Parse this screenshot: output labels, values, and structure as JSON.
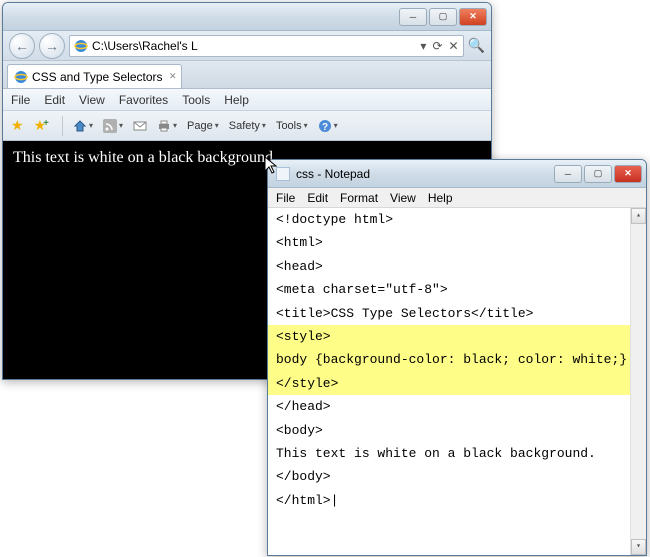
{
  "ie": {
    "address": "C:\\Users\\Rachel's L",
    "tab_title": "CSS and Type Selectors",
    "menu": {
      "file": "File",
      "edit": "Edit",
      "view": "View",
      "favorites": "Favorites",
      "tools": "Tools",
      "help": "Help"
    },
    "toolbar": {
      "page": "Page",
      "safety": "Safety",
      "tools": "Tools"
    },
    "page_text": "This text is white on a black background."
  },
  "notepad": {
    "title": "css - Notepad",
    "menu": {
      "file": "File",
      "edit": "Edit",
      "format": "Format",
      "view": "View",
      "help": "Help"
    },
    "lines": [
      "<!doctype html>",
      "<html>",
      "<head>",
      "<meta charset=\"utf-8\">",
      "<title>CSS Type Selectors</title>",
      "<style>",
      "body {background-color: black; color: white;}",
      "</style>",
      "</head>",
      "<body>",
      "This text is white on a black background.",
      "</body>",
      "</html>|"
    ],
    "highlight_rows": [
      5,
      6,
      7
    ]
  },
  "winctl": {
    "min": "─",
    "max": "▢",
    "close": "✕",
    "refresh": "⟳",
    "search": "🔍",
    "back": "←",
    "fwd": "→",
    "drop": "▾",
    "up": "▴",
    "down": "▾"
  }
}
